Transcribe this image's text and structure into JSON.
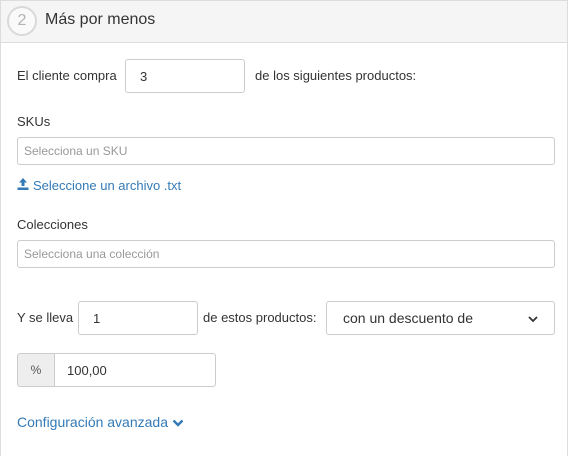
{
  "header": {
    "step_number": "2",
    "title": "Más por menos"
  },
  "buy": {
    "prefix": "El cliente compra",
    "quantity": "3",
    "suffix": "de los siguientes productos:"
  },
  "skus": {
    "label": "SKUs",
    "placeholder": "Selecciona un SKU",
    "upload_link": "Seleccione un archivo .txt"
  },
  "collections": {
    "label": "Colecciones",
    "placeholder": "Selecciona una colección"
  },
  "get": {
    "prefix": "Y se lleva",
    "quantity": "1",
    "middle": "de estos productos:",
    "discount_type_selected": "con un descuento de"
  },
  "discount": {
    "unit": "%",
    "value": "100,00"
  },
  "advanced_link": "Configuración avanzada",
  "colors": {
    "link": "#337ab7",
    "border": "#cccccc",
    "header_bg": "#f5f5f5"
  }
}
